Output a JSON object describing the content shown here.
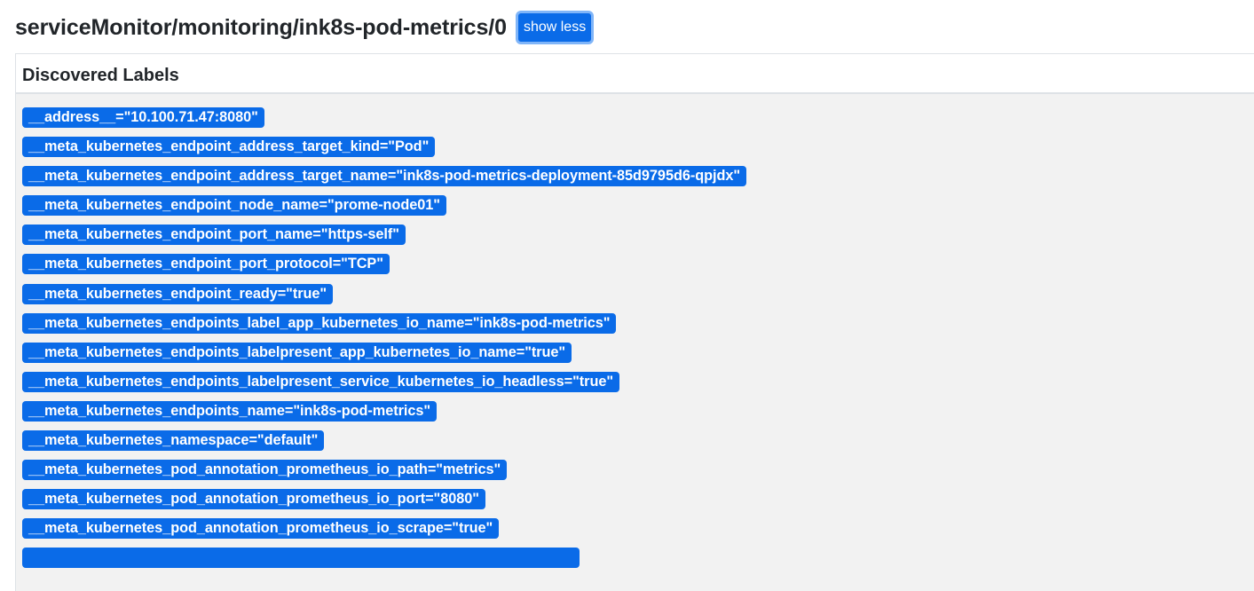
{
  "header": {
    "title": "serviceMonitor/monitoring/ink8s-pod-metrics/0",
    "toggle_label": "show less"
  },
  "table": {
    "column_header": "Discovered Labels",
    "labels": [
      "__address__=\"10.100.71.47:8080\"",
      "__meta_kubernetes_endpoint_address_target_kind=\"Pod\"",
      "__meta_kubernetes_endpoint_address_target_name=\"ink8s-pod-metrics-deployment-85d9795d6-qpjdx\"",
      "__meta_kubernetes_endpoint_node_name=\"prome-node01\"",
      "__meta_kubernetes_endpoint_port_name=\"https-self\"",
      "__meta_kubernetes_endpoint_port_protocol=\"TCP\"",
      "__meta_kubernetes_endpoint_ready=\"true\"",
      "__meta_kubernetes_endpoints_label_app_kubernetes_io_name=\"ink8s-pod-metrics\"",
      "__meta_kubernetes_endpoints_labelpresent_app_kubernetes_io_name=\"true\"",
      "__meta_kubernetes_endpoints_labelpresent_service_kubernetes_io_headless=\"true\"",
      "__meta_kubernetes_endpoints_name=\"ink8s-pod-metrics\"",
      "__meta_kubernetes_namespace=\"default\"",
      "__meta_kubernetes_pod_annotation_prometheus_io_path=\"metrics\"",
      "__meta_kubernetes_pod_annotation_prometheus_io_port=\"8080\"",
      "__meta_kubernetes_pod_annotation_prometheus_io_scrape=\"true\""
    ]
  },
  "colors": {
    "badge": "#0a6be8",
    "button": "#0a6be8",
    "button_focus_ring": "#80b5f8",
    "panel_background": "#f2f2f2"
  }
}
